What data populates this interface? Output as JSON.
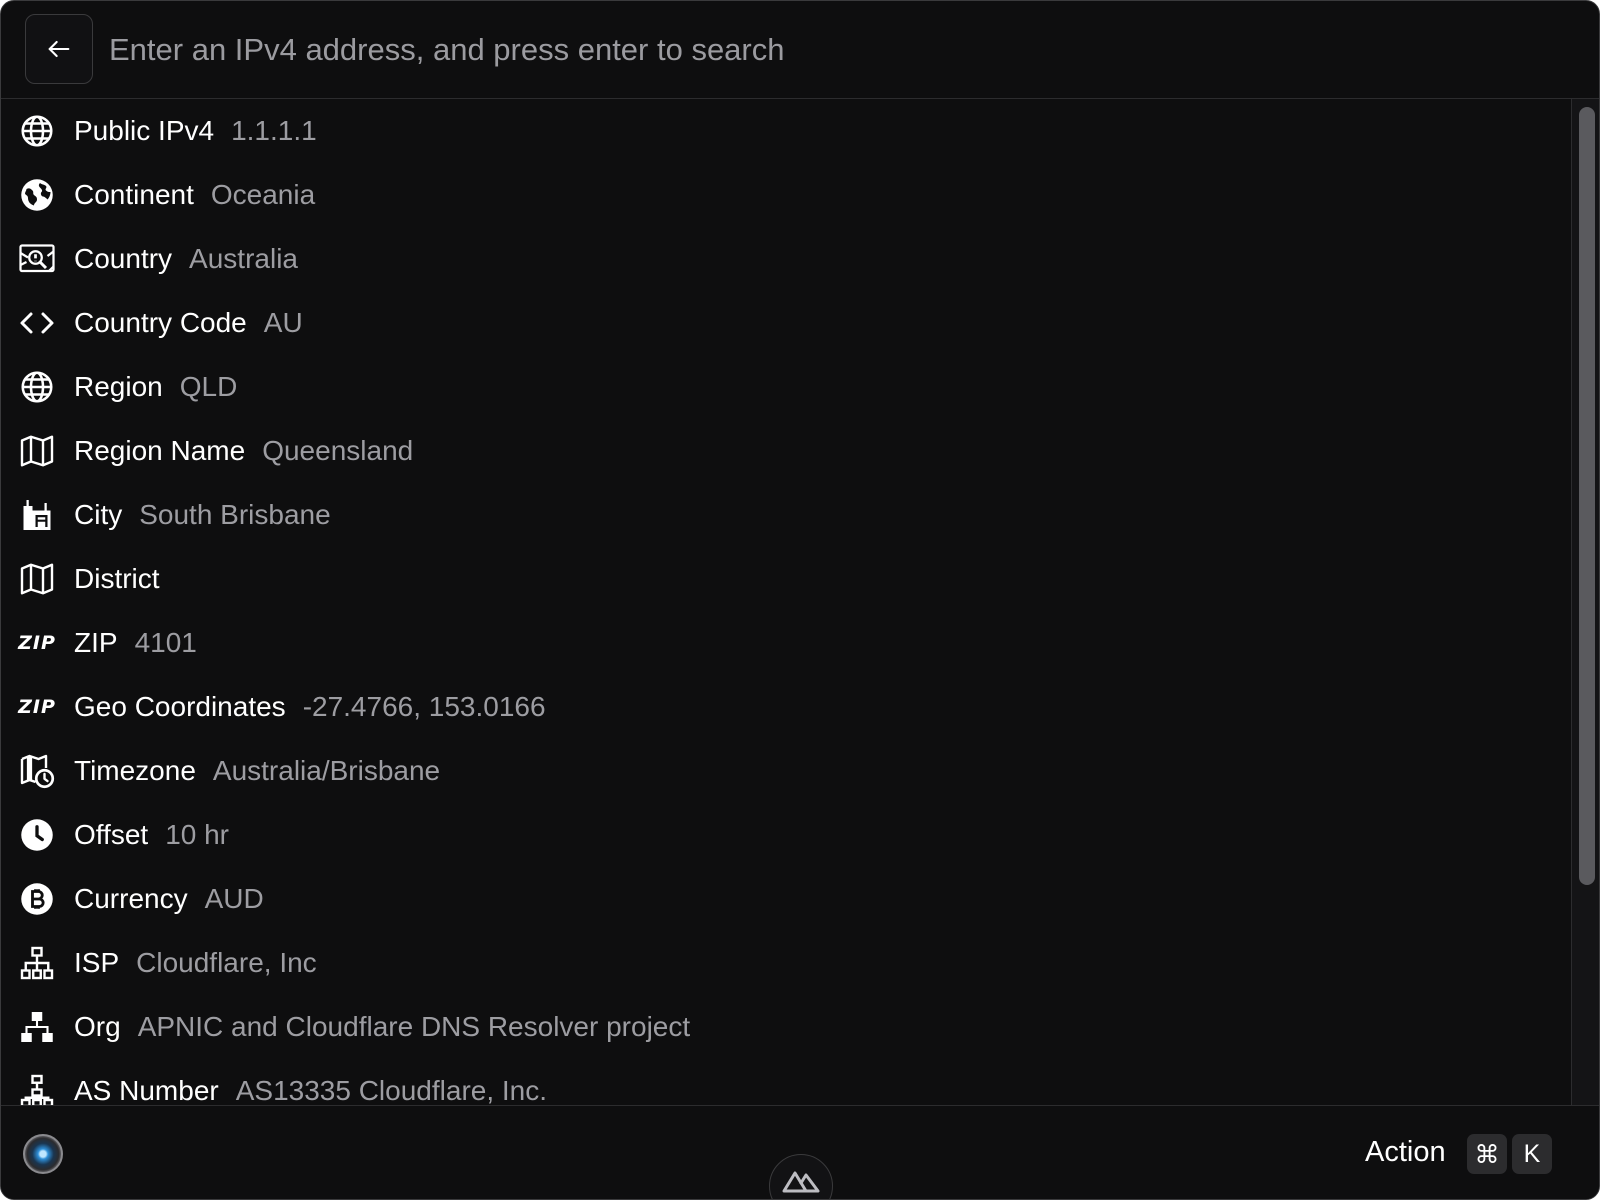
{
  "search": {
    "placeholder": "Enter an IPv4 address, and press enter to search",
    "value": ""
  },
  "items": [
    {
      "label": "Public IPv4",
      "value": "1.1.1.1",
      "icon": "globe-icon"
    },
    {
      "label": "Continent",
      "value": "Oceania",
      "icon": "earth-icon"
    },
    {
      "label": "Country",
      "value": "Australia",
      "icon": "map-pin-search-icon"
    },
    {
      "label": "Country Code",
      "value": "AU",
      "icon": "code-brackets-icon"
    },
    {
      "label": "Region",
      "value": "QLD",
      "icon": "globe-icon"
    },
    {
      "label": "Region Name",
      "value": "Queensland",
      "icon": "map-icon"
    },
    {
      "label": "City",
      "value": "South Brisbane",
      "icon": "city-buildings-icon"
    },
    {
      "label": "District",
      "value": "",
      "icon": "map-icon"
    },
    {
      "label": "ZIP",
      "value": "4101",
      "icon": "zip-icon"
    },
    {
      "label": "Geo Coordinates",
      "value": "-27.4766, 153.0166",
      "icon": "zip-icon"
    },
    {
      "label": "Timezone",
      "value": "Australia/Brisbane",
      "icon": "map-clock-icon"
    },
    {
      "label": "Offset",
      "value": "10 hr",
      "icon": "clock-icon"
    },
    {
      "label": "Currency",
      "value": "AUD",
      "icon": "bitcoin-icon"
    },
    {
      "label": "ISP",
      "value": "Cloudflare, Inc",
      "icon": "network-icon"
    },
    {
      "label": "Org",
      "value": "APNIC and Cloudflare DNS Resolver project",
      "icon": "network-filled-icon"
    },
    {
      "label": "AS Number",
      "value": "AS13335 Cloudflare, Inc.",
      "icon": "network-tree-icon"
    }
  ],
  "footer": {
    "action_label": "Action",
    "shortcut_cmd": "⌘",
    "shortcut_key": "K"
  }
}
